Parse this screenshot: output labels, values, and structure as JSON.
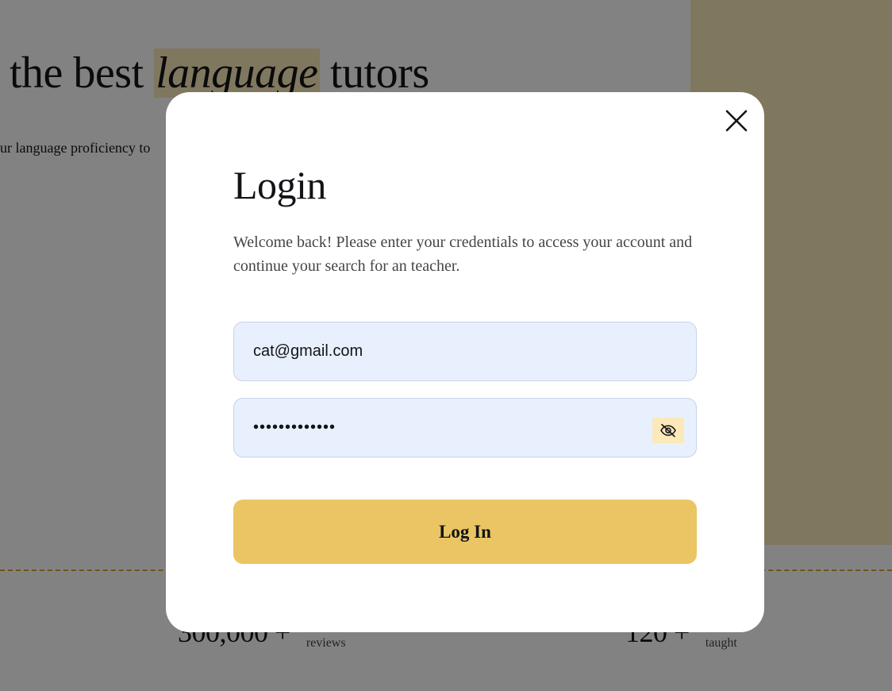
{
  "hero": {
    "title_before": "the best ",
    "title_accent": "language",
    "title_after": " tutors",
    "subtitle": "ur language proficiency to"
  },
  "stats": [
    {
      "value": "300,000 +",
      "label": "reviews"
    },
    {
      "value": "120 +",
      "label": "taught"
    }
  ],
  "modal": {
    "title": "Login",
    "description": "Welcome back! Please enter your credentials to access your account and continue your search for an teacher.",
    "email_value": "cat@gmail.com",
    "password_value": "•••••••••••••",
    "submit_label": "Log In",
    "close_icon": "close-icon",
    "visibility_icon": "eye-off-icon"
  },
  "colors": {
    "accent": "#ebc564",
    "accent_light": "#fbe9ba",
    "input_bg": "#e8f0fe",
    "overlay": "rgba(0,0,0,0.49)"
  }
}
